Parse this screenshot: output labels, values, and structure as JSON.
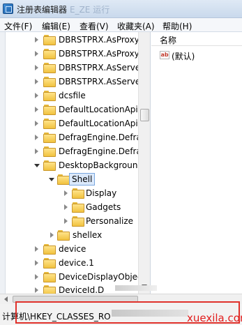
{
  "window": {
    "title": "注册表编辑器",
    "ghost_title": "E_ZE 运行"
  },
  "menu": [
    {
      "label": "文件(F)"
    },
    {
      "label": "编辑(E)"
    },
    {
      "label": "查看(V)"
    },
    {
      "label": "收藏夹(A)"
    },
    {
      "label": "帮助(H)"
    }
  ],
  "tree": [
    {
      "label": "DBRSTPRX.AsProxy",
      "state": "collapsed",
      "level": 0
    },
    {
      "label": "DBRSTPRX.AsProxy.",
      "state": "collapsed",
      "level": 0
    },
    {
      "label": "DBRSTPRX.AsServer",
      "state": "collapsed",
      "level": 0
    },
    {
      "label": "DBRSTPRX.AsServer",
      "state": "collapsed",
      "level": 0
    },
    {
      "label": "dcsfile",
      "state": "collapsed",
      "level": 0
    },
    {
      "label": "DefaultLocationApi",
      "state": "collapsed",
      "level": 0
    },
    {
      "label": "DefaultLocationApi.",
      "state": "collapsed",
      "level": 0
    },
    {
      "label": "DefragEngine.Defra",
      "state": "collapsed",
      "level": 0
    },
    {
      "label": "DefragEngine.Defra",
      "state": "collapsed",
      "level": 0
    },
    {
      "label": "DesktopBackgrounc",
      "state": "expanded",
      "level": 0
    },
    {
      "label": "Shell",
      "state": "expanded",
      "level": 1,
      "selected": true
    },
    {
      "label": "Display",
      "state": "collapsed",
      "level": 2
    },
    {
      "label": "Gadgets",
      "state": "collapsed",
      "level": 2
    },
    {
      "label": "Personalize",
      "state": "collapsed",
      "level": 2
    },
    {
      "label": "shellex",
      "state": "collapsed",
      "level": 1
    },
    {
      "label": "device",
      "state": "collapsed",
      "level": 0
    },
    {
      "label": "device.1",
      "state": "collapsed",
      "level": 0
    },
    {
      "label": "DeviceDisplayObjec",
      "state": "collapsed",
      "level": 0
    },
    {
      "label": "DeviceId.D",
      "state": "collapsed",
      "level": 0
    }
  ],
  "values_pane": {
    "column_name": "名称",
    "rows": [
      {
        "icon": "string-value-icon",
        "icon_text": "ab",
        "name": "(默认)"
      }
    ]
  },
  "status": {
    "path": "计算机\\HKEY_CLASSES_RO"
  },
  "watermark": "xuexila.com",
  "colors": {
    "highlight": "#e0312b",
    "selection": "#dbe9fb"
  }
}
